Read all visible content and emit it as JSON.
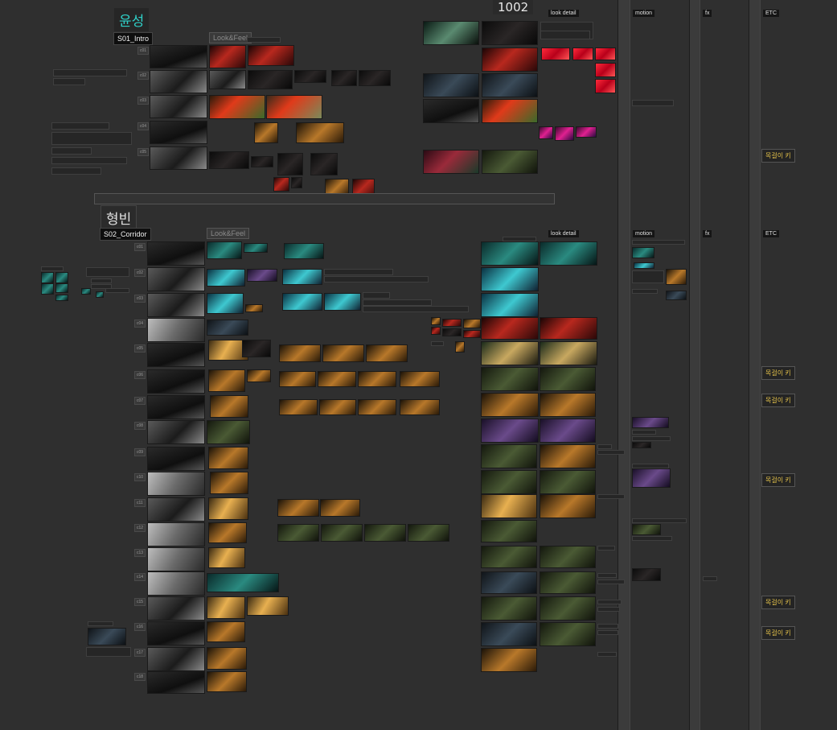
{
  "sections": [
    {
      "title": "윤성",
      "scene_label": "S01_Intro",
      "look_label": "Look&Feel"
    },
    {
      "title": "형빈",
      "scene_label": "S02_Corridor",
      "look_label": "Look&Feel"
    }
  ],
  "top_number": "1002",
  "column_headers": {
    "look_detail_1": "look detail",
    "motion_1": "motion",
    "fx_1": "fx",
    "etc_1": "ETC",
    "look_detail_2": "look detail",
    "motion_2": "motion",
    "fx_2": "fx",
    "etc_2": "ETC"
  },
  "etc_tags": [
    "목걸이 키",
    "목걸이 키",
    "목걸이 키",
    "목걸이 키",
    "목걸이 키",
    "목걸이 키"
  ],
  "shots_s01": [
    "c01",
    "c02",
    "c03",
    "c04",
    "c05"
  ],
  "shots_s02": [
    "c01",
    "c02",
    "c03",
    "c04",
    "c05",
    "c06",
    "c07",
    "c08",
    "c09",
    "c10",
    "c11",
    "c12",
    "c13",
    "c14",
    "c15",
    "c16",
    "c17",
    "c18",
    "c19"
  ],
  "colors": {
    "background": "#2f2f2f",
    "section_title": "#2fd0c8",
    "etc_tag": "#e6c34a"
  }
}
